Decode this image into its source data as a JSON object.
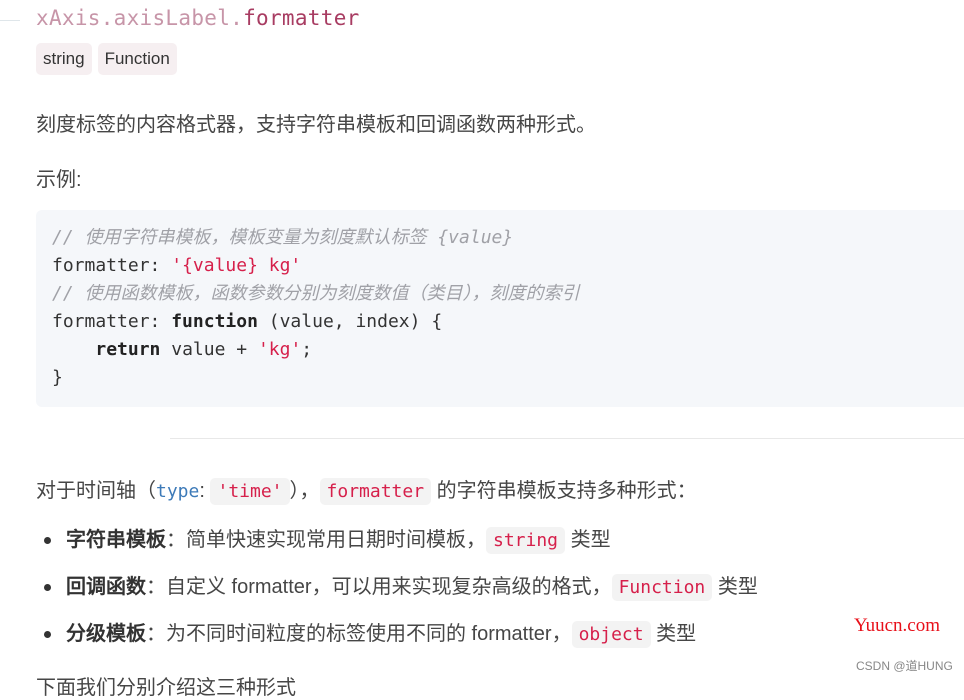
{
  "header": {
    "path": "xAxis.axisLabel.",
    "name": "formatter",
    "types": [
      "string",
      "Function"
    ]
  },
  "description": "刻度标签的内容格式器，支持字符串模板和回调函数两种形式。",
  "example_label": "示例:",
  "code": {
    "comment1": "// 使用字符串模板，模板变量为刻度默认标签 {value}",
    "line2_key": "formatter: ",
    "line2_str": "'{value} kg'",
    "comment2": "// 使用函数模板，函数参数分别为刻度数值（类目），刻度的索引",
    "line4_key": "formatter: ",
    "line4_kw": "function",
    "line4_rest": " (value, index) {",
    "line5_indent": "    ",
    "line5_kw": "return",
    "line5_mid": " value + ",
    "line5_str": "'kg'",
    "line5_end": ";",
    "line6": "}"
  },
  "time_para": {
    "prefix": "对于时间轴（",
    "type_kw": "type",
    "colon": ": ",
    "time_val": "'time'",
    "close": "），",
    "formatter_code": "formatter",
    "suffix": " 的字符串模板支持多种形式："
  },
  "list": [
    {
      "bold": "字符串模板",
      "text": "：简单快速实现常用日期时间模板，",
      "code": "string",
      "suffix": " 类型"
    },
    {
      "bold": "回调函数",
      "text": "：自定义 formatter，可以用来实现复杂高级的格式，",
      "code": "Function",
      "suffix": " 类型"
    },
    {
      "bold": "分级模板",
      "text": "：为不同时间粒度的标签使用不同的 formatter，",
      "code": "object",
      "suffix": " 类型"
    }
  ],
  "cut_line": "下面我们分别介绍这三种形式",
  "watermark": {
    "main": "Yuucn.com",
    "sub": "CSDN @道HUNG"
  }
}
